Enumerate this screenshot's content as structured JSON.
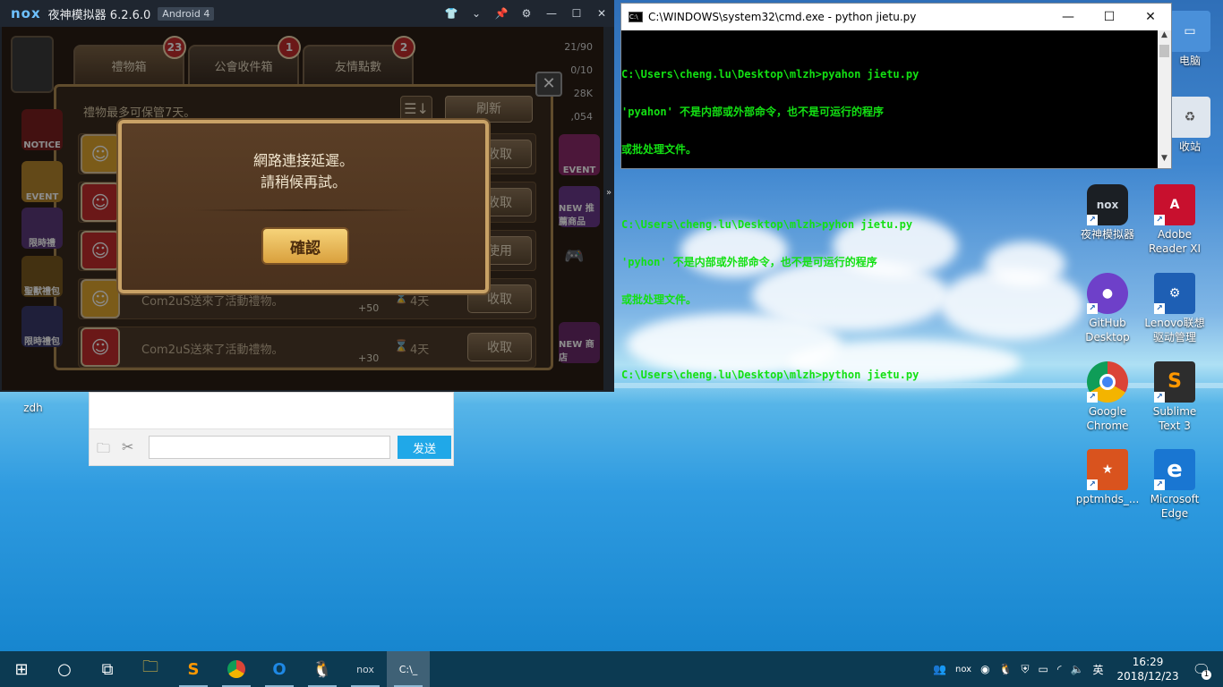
{
  "nox": {
    "logo": "nox",
    "title": "夜神模拟器 6.2.6.0",
    "android": "Android 4",
    "side_toggle": "»",
    "game": {
      "tabs": [
        {
          "label": "禮物箱",
          "badge": "23"
        },
        {
          "label": "公會收件箱",
          "badge": "1"
        },
        {
          "label": "友情點數",
          "badge": "2"
        }
      ],
      "notice": "禮物最多可保管7天。",
      "refresh": "刷新",
      "rows": [
        {
          "text": "",
          "reward": "",
          "days": "",
          "btn": "收取"
        },
        {
          "text": "",
          "reward": "",
          "days": "",
          "btn": "收取"
        },
        {
          "text": "",
          "reward": "",
          "days": "",
          "btn": "使用"
        },
        {
          "text": "Com2uS送來了活動禮物。",
          "reward": "+50",
          "days": "4天",
          "btn": "收取"
        },
        {
          "text": "Com2uS送來了活動禮物。",
          "reward": "+30",
          "days": "4天",
          "btn": "收取"
        }
      ],
      "left_labels": [
        "NOTICE",
        "EVENT",
        "限時禮",
        "聖獸禮包",
        "EVENT",
        "限時禮包"
      ],
      "right_labels": [
        "EVENT",
        "NEW 推薦商品",
        "NEW 商店"
      ],
      "top_right_counts": [
        "21/90",
        "0/10",
        "28K",
        ",054"
      ],
      "dialog": {
        "line1": "網路連接延遲。",
        "line2": "請稍候再試。",
        "ok": "確認"
      }
    }
  },
  "cmd": {
    "title": "C:\\WINDOWS\\system32\\cmd.exe - python  jietu.py",
    "lines": [
      "C:\\Users\\cheng.lu\\Desktop\\mlzh>pyahon jietu.py",
      "'pyahon' 不是内部或外部命令，也不是可运行的程序",
      "或批处理文件。",
      "",
      "C:\\Users\\cheng.lu\\Desktop\\mlzh>pyhon jietu.py",
      "'pyhon' 不是内部或外部命令，也不是可运行的程序",
      "或批处理文件。",
      "",
      "C:\\Users\\cheng.lu\\Desktop\\mlzh>python jietu.py"
    ]
  },
  "chat": {
    "input_value": "",
    "send": "发送"
  },
  "desktop_icons": [
    {
      "label": "电脑",
      "icon": "computer-icon"
    },
    {
      "label": "收站",
      "icon": "recycle-bin-icon"
    },
    {
      "label": "夜神模拟器",
      "icon": "nox-icon",
      "color": "#1b1f24"
    },
    {
      "label": "Adobe Reader XI",
      "icon": "adobe-reader-icon",
      "color": "#c8102e"
    },
    {
      "label": "GitHub Desktop",
      "icon": "github-icon",
      "color": "#6e40c9"
    },
    {
      "label": "Lenovo联想驱动管理",
      "icon": "lenovo-driver-icon",
      "color": "#1e5fb4"
    },
    {
      "label": "Google Chrome",
      "icon": "chrome-icon",
      "color": "#ffffff"
    },
    {
      "label": "Sublime Text 3",
      "icon": "sublime-icon",
      "color": "#2d2d2d"
    },
    {
      "label": "pptmhds_...",
      "icon": "ppt-icon",
      "color": "#d9531e"
    },
    {
      "label": "Microsoft Edge",
      "icon": "edge-icon",
      "color": "#1976d2"
    },
    {
      "label": "zdh",
      "icon": "file-icon",
      "color": "#ffffff"
    }
  ],
  "taskbar": {
    "apps": [
      "start-icon",
      "cortana-icon",
      "task-view-icon",
      "file-explorer-icon",
      "sublime-icon",
      "chrome-icon",
      "outlook-icon",
      "qq-icon",
      "nox-icon",
      "cmd-icon"
    ],
    "ime": "英",
    "time": "16:29",
    "date": "2018/12/23",
    "notifications": "1"
  }
}
